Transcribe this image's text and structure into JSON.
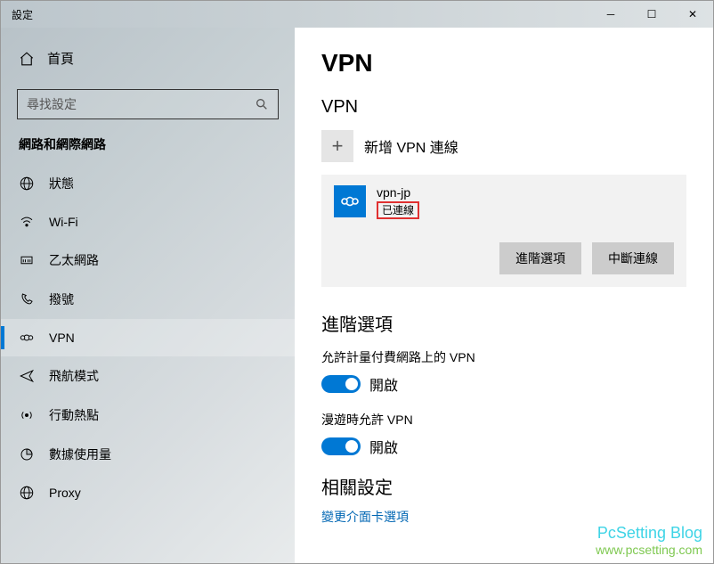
{
  "titlebar": {
    "title": "設定"
  },
  "sidebar": {
    "home": "首頁",
    "search_placeholder": "尋找設定",
    "section": "網路和網際網路",
    "items": [
      {
        "label": "狀態"
      },
      {
        "label": "Wi-Fi"
      },
      {
        "label": "乙太網路"
      },
      {
        "label": "撥號"
      },
      {
        "label": "VPN"
      },
      {
        "label": "飛航模式"
      },
      {
        "label": "行動熱點"
      },
      {
        "label": "數據使用量"
      },
      {
        "label": "Proxy"
      }
    ]
  },
  "main": {
    "page_title": "VPN",
    "vpn_section": "VPN",
    "add_vpn": "新增 VPN 連線",
    "conn": {
      "name": "vpn-jp",
      "status": "已連線"
    },
    "btn_advanced": "進階選項",
    "btn_disconnect": "中斷連線",
    "advanced_title": "進階選項",
    "opt1_label": "允許計量付費網路上的 VPN",
    "opt1_state": "開啟",
    "opt2_label": "漫遊時允許 VPN",
    "opt2_state": "開啟",
    "related_title": "相關設定",
    "related_link": "變更介面卡選項"
  },
  "watermark": {
    "l1": "PcSetting Blog",
    "l2": "www.pcsetting.com"
  }
}
